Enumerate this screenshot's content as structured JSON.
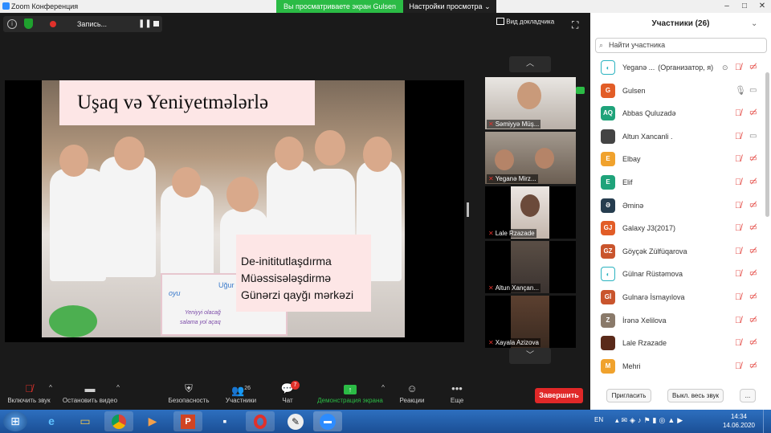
{
  "titlebar": {
    "title": "Zoom Конференция",
    "share_banner": "Вы просматриваете экран Gulsen",
    "view_options": "Настройки просмотра"
  },
  "recording": {
    "label": "Запись..."
  },
  "speaker_view": "Вид докладчика",
  "slide": {
    "title": "Uşaq və Yeniyetmələrlə",
    "box_lines": [
      "De-inititutlaşdırma",
      "Müəssisələşdirmə",
      "Günərzi qayğı mərkəzi"
    ],
    "cake_text_1": "oyu",
    "cake_text_2": "Uğur",
    "cake_text_3": "Yeniyyi olacağ",
    "cake_text_4": "salama yol açaq"
  },
  "thumbnails": [
    {
      "name": "Səmiyyə Müş..."
    },
    {
      "name": "Yeganə Mirz..."
    },
    {
      "name": "Lale Rzazade"
    },
    {
      "name": "Altun Xançan..."
    },
    {
      "name": "Xayala Azizova"
    }
  ],
  "toolbar": {
    "audio": "Включить звук",
    "video": "Остановить видео",
    "security": "Безопасность",
    "participants": "Участники",
    "participants_count": "26",
    "chat": "Чат",
    "chat_badge": "7",
    "share": "Демонстрация экрана",
    "reactions": "Реакции",
    "more": "Еще",
    "end": "Завершить"
  },
  "panel": {
    "title": "Участники (26)",
    "search_placeholder": "Найти участника",
    "participants": [
      {
        "initials": "",
        "name": "Yeganə ...",
        "extra": "(Организатор, я)",
        "color": "#ffffff"
      },
      {
        "initials": "G",
        "name": "Gulsen",
        "extra": "",
        "color": "#e25d27"
      },
      {
        "initials": "AQ",
        "name": "Abbas Quluzadə",
        "extra": "",
        "color": "#1fa37a"
      },
      {
        "initials": "",
        "name": "Altun Xancanli .",
        "extra": "",
        "color": "#444444"
      },
      {
        "initials": "E",
        "name": "Elbay",
        "extra": "",
        "color": "#f0a22d"
      },
      {
        "initials": "E",
        "name": "Elif",
        "extra": "",
        "color": "#1fa37a"
      },
      {
        "initials": "Ə",
        "name": "Əminə",
        "extra": "",
        "color": "#263d4f"
      },
      {
        "initials": "GJ",
        "name": "Galaxy J3(2017)",
        "extra": "",
        "color": "#e25d27"
      },
      {
        "initials": "GZ",
        "name": "Göyçək Zülfüqarova",
        "extra": "",
        "color": "#c9552d"
      },
      {
        "initials": "",
        "name": "Gülnar Rüstəmova",
        "extra": "",
        "color": "#ffffff"
      },
      {
        "initials": "Gİ",
        "name": "Gulnarə İsmayılova",
        "extra": "",
        "color": "#c9552d"
      },
      {
        "initials": "Z",
        "name": "İrənə Xelilova",
        "extra": "",
        "color": "#8a7a6a"
      },
      {
        "initials": "",
        "name": "Lale Rzazade",
        "extra": "",
        "color": "#5a2a1a"
      },
      {
        "initials": "M",
        "name": "Mehri",
        "extra": "",
        "color": "#f0a22d"
      }
    ],
    "invite": "Пригласить",
    "mute_all": "Выкл. весь звук",
    "more": "..."
  },
  "taskbar": {
    "lang": "EN",
    "time": "14:34",
    "date": "14.06.2020"
  },
  "colors": {
    "accent_blue": "#2d8cff",
    "share_green": "#2bbb45",
    "end_red": "#e02828",
    "muted_red": "#e0312b"
  }
}
